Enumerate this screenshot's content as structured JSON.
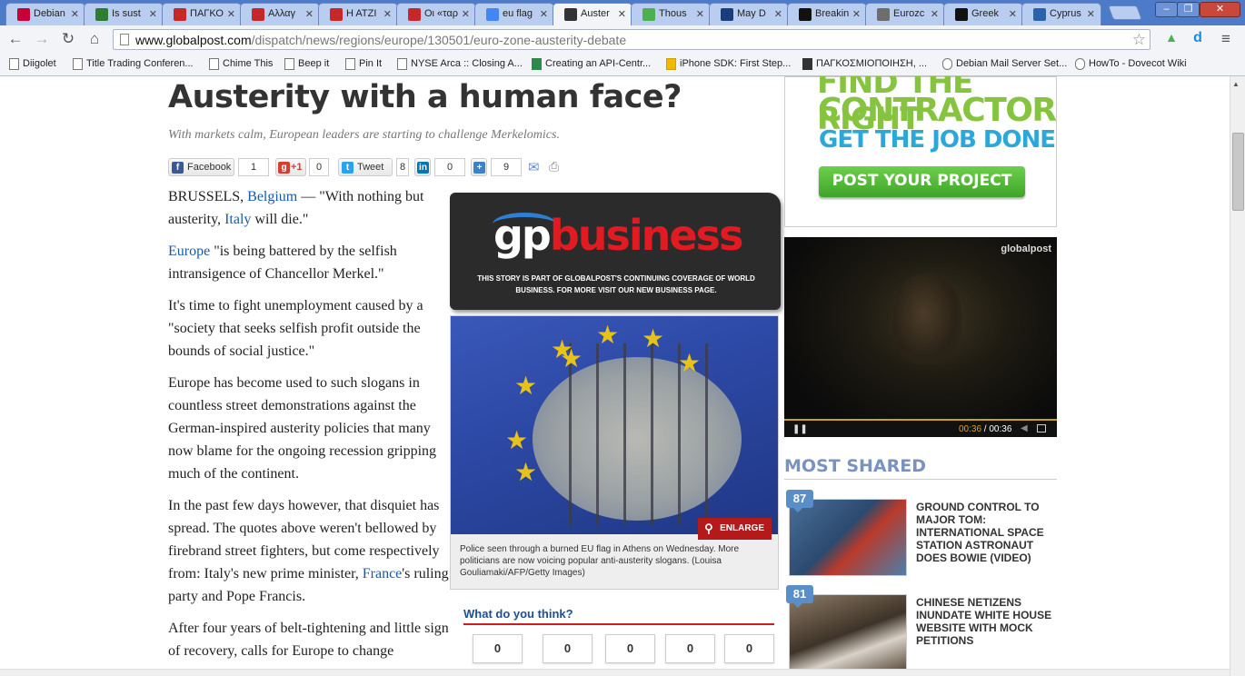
{
  "tabs": [
    {
      "label": "Debian",
      "icon": "debian-icon",
      "color": "#c70036"
    },
    {
      "label": "Is sust",
      "icon": "flag-icon",
      "color": "#2e7d32"
    },
    {
      "label": "ΠΑΓΚΟ",
      "icon": "greek-news-icon",
      "color": "#c62828"
    },
    {
      "label": "Αλλαγ",
      "icon": "greek-news-icon",
      "color": "#c62828"
    },
    {
      "label": "Η ΑΤΖΙ",
      "icon": "greek-news-icon",
      "color": "#c62828"
    },
    {
      "label": "Οι «ταρ",
      "icon": "greek-news-icon",
      "color": "#c62828"
    },
    {
      "label": "eu flag",
      "icon": "google-icon",
      "color": "#4285f4"
    },
    {
      "label": "Auster",
      "icon": "globalpost-icon",
      "color": "#333333",
      "active": true
    },
    {
      "label": "Thous",
      "icon": "shield-icon",
      "color": "#4caf50"
    },
    {
      "label": "May D",
      "icon": "ibt-icon",
      "color": "#1a3d7c"
    },
    {
      "label": "Breakin",
      "icon": "it-icon",
      "color": "#111111"
    },
    {
      "label": "Eurozc",
      "icon": "h-icon",
      "color": "#6d6d6d"
    },
    {
      "label": "Greek",
      "icon": "it-icon",
      "color": "#111111"
    },
    {
      "label": "Cyprus",
      "icon": "cyprus-icon",
      "color": "#2962a8"
    }
  ],
  "url": {
    "host": "www.globalpost.com",
    "path": "/dispatch/news/regions/europe/130501/euro-zone-austerity-debate"
  },
  "bookmarks": [
    {
      "label": "Diigolet",
      "icon": "page-icon"
    },
    {
      "label": "Title Trading Conferen...",
      "icon": "page-icon"
    },
    {
      "label": "Chime This",
      "icon": "page-icon"
    },
    {
      "label": "Beep it",
      "icon": "page-icon"
    },
    {
      "label": "Pin It",
      "icon": "page-icon"
    },
    {
      "label": "NYSE Arca :: Closing A...",
      "icon": "page-icon"
    },
    {
      "label": "Creating an API-Centr...",
      "icon": "green-icon"
    },
    {
      "label": "iPhone SDK: First Step...",
      "icon": "yellow-icon"
    },
    {
      "label": "ΠΑΓΚΟΣΜΙΟΠΟΙΗΣΗ, ...",
      "icon": "s-icon"
    },
    {
      "label": "Debian Mail Server Set...",
      "icon": "debian-icon"
    },
    {
      "label": "HowTo - Dovecot Wiki",
      "icon": "dovecot-icon"
    }
  ],
  "article": {
    "headline": "Austerity with a human face?",
    "dek": "With markets calm, European leaders are starting to challenge Merkelomics.",
    "share": {
      "facebook_label": "Facebook",
      "facebook_count": "1",
      "gplus_label": "+1",
      "gplus_count": "0",
      "tweet_label": "Tweet",
      "tweet_count": "8",
      "linkedin_count": "0",
      "plus_count": "9"
    },
    "p1_a": "BRUSSELS, ",
    "p1_link": "Belgium",
    "p1_b": " — \"With nothing but austerity, ",
    "p1_link2": "Italy",
    "p1_c": " will die.\"",
    "p2_link": "Europe",
    "p2_b": " \"is being battered by the selfish intransigence of Chancellor Merkel.\"",
    "p3": "It's time to fight unemployment caused by a \"society that seeks selfish profit outside the bounds of social justice.\"",
    "p4": "Europe has become used to such slogans in countless street demonstrations against the German-inspired austerity policies that many now blame for the ongoing recession gripping much of the continent.",
    "p5_a": "In the past few days however, that disquiet has spread. The quotes above weren't bellowed by firebrand street fighters, but come respectively from: Italy's new prime minister, ",
    "p5_link": "France",
    "p5_b": "'s ruling party and Pope Francis.",
    "p6": "After four years of belt-tightening and little sign of recovery, calls for Europe to change"
  },
  "gpbusiness": {
    "logo_gp": "gp",
    "logo_biz": "business",
    "note": "THIS STORY IS PART OF GLOBALPOST'S CONTINUING COVERAGE OF WORLD BUSINESS. FOR MORE VISIT OUR NEW BUSINESS PAGE."
  },
  "photo": {
    "enlarge": "ENLARGE",
    "caption": "Police seen through a burned EU flag in Athens on Wednesday. More politicians are now voicing popular anti-austerity slogans. (Louisa Gouliamaki/AFP/Getty Images)"
  },
  "think": {
    "title": "What do you think?",
    "votes": [
      "0",
      "0",
      "0",
      "0",
      "0"
    ]
  },
  "ad": {
    "line1": "FIND THE RIGHT",
    "line2": "CONTRACTOR",
    "line3": "GET THE JOB DONE",
    "button": "POST YOUR PROJECT"
  },
  "video": {
    "brand": "globalpost",
    "current": "00:36",
    "total": "00:36"
  },
  "most_shared": {
    "title": "MOST SHARED",
    "items": [
      {
        "count": "87",
        "title": "GROUND CONTROL TO MAJOR TOM: INTERNATIONAL SPACE STATION ASTRONAUT DOES BOWIE (VIDEO)"
      },
      {
        "count": "81",
        "title": "CHINESE NETIZENS INUNDATE WHITE HOUSE WEBSITE WITH MOCK PETITIONS"
      }
    ]
  }
}
